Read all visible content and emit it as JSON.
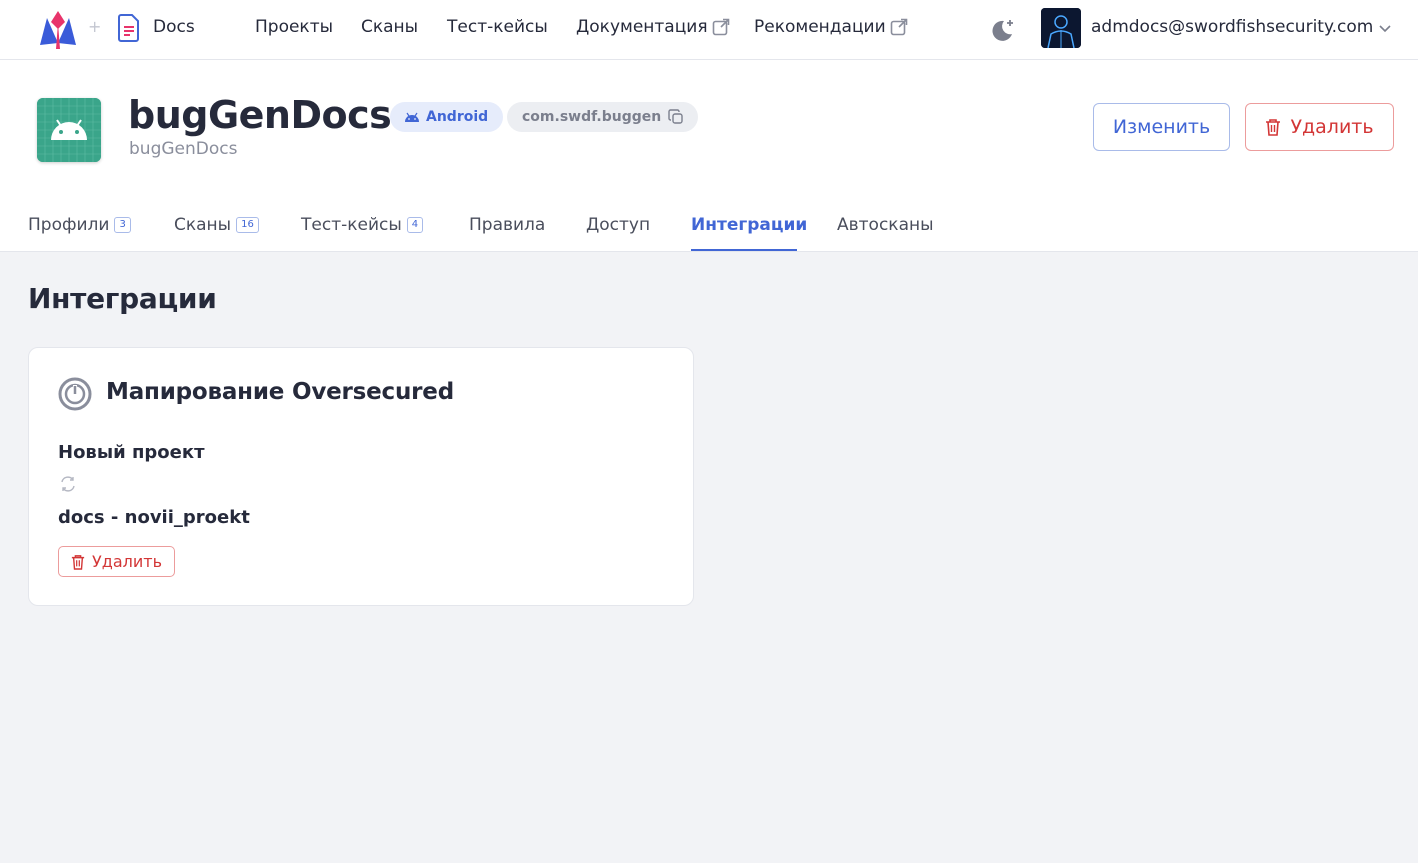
{
  "nav": {
    "brand_sep": "+",
    "docs_label": "Docs",
    "items": [
      {
        "label": "Проекты",
        "external": false
      },
      {
        "label": "Сканы",
        "external": false
      },
      {
        "label": "Тест-кейсы",
        "external": false
      },
      {
        "label": "Документация",
        "external": true
      },
      {
        "label": "Рекомендации",
        "external": true
      }
    ],
    "user_email": "admdocs@swordfishsecurity.com"
  },
  "project": {
    "title": "bugGenDocs",
    "subtitle": "bugGenDocs",
    "platform": "Android",
    "package": "com.swdf.buggen",
    "edit_label": "Изменить",
    "delete_label": "Удалить"
  },
  "tabs": [
    {
      "label": "Профили",
      "count": "3",
      "active": false
    },
    {
      "label": "Сканы",
      "count": "16",
      "active": false
    },
    {
      "label": "Тест-кейсы",
      "count": "4",
      "active": false
    },
    {
      "label": "Правила",
      "count": null,
      "active": false
    },
    {
      "label": "Доступ",
      "count": null,
      "active": false
    },
    {
      "label": "Интеграции",
      "count": null,
      "active": true
    },
    {
      "label": "Автосканы",
      "count": null,
      "active": false
    }
  ],
  "main": {
    "section_title": "Интеграции",
    "integration": {
      "title": "Мапирование Oversecured",
      "source": "Новый проект",
      "target": "docs - novii_proekt",
      "delete_label": "Удалить"
    }
  },
  "colors": {
    "accent": "#4166d5",
    "danger": "#d33636",
    "background": "#f2f3f6",
    "app_icon": "#3aa58a"
  }
}
